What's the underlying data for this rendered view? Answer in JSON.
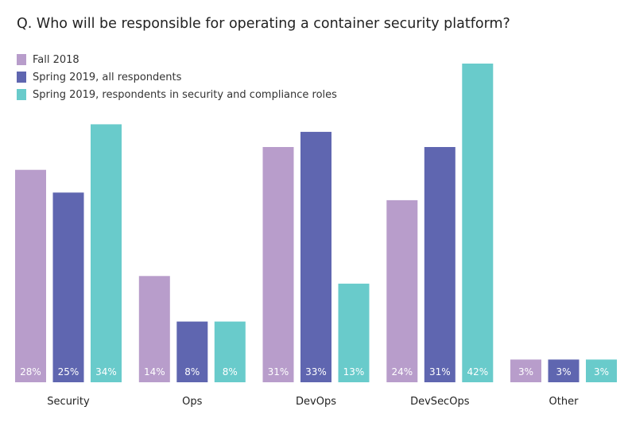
{
  "chart_data": {
    "type": "bar",
    "title": "Q. Who will be responsible for operating a container security platform?",
    "categories": [
      "Security",
      "Ops",
      "DevOps",
      "DevSecOps",
      "Other"
    ],
    "series": [
      {
        "name": "Fall 2018",
        "color": "#b89dcb",
        "values": [
          28,
          14,
          31,
          24,
          3
        ],
        "labels": [
          "28%",
          "14%",
          "31%",
          "24%",
          "3%"
        ]
      },
      {
        "name": "Spring 2019, all respondents",
        "color": "#5f66b0",
        "values": [
          25,
          8,
          33,
          31,
          3
        ],
        "labels": [
          "25%",
          "8%",
          "33%",
          "31%",
          "3%"
        ]
      },
      {
        "name": "Spring 2019, respondents in security and compliance roles",
        "color": "#69cbcb",
        "values": [
          34,
          8,
          13,
          42,
          3
        ],
        "labels": [
          "34%",
          "8%",
          "13%",
          "42%",
          "3%"
        ]
      }
    ],
    "ylim": [
      0,
      42
    ],
    "legend_position": "top-left",
    "grid": false
  }
}
